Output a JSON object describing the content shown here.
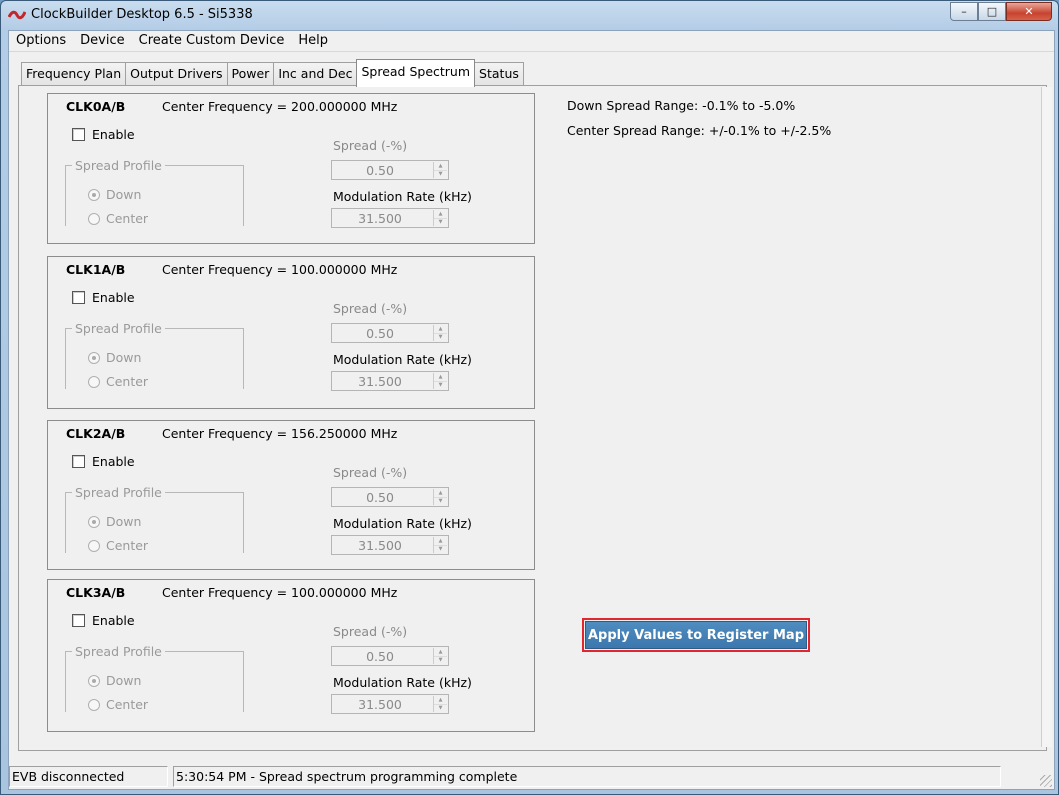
{
  "window": {
    "title": "ClockBuilder Desktop 6.5 - Si5338",
    "buttons": {
      "minimize": "–",
      "maximize": "□",
      "close": "✕"
    }
  },
  "menu": [
    "Options",
    "Device",
    "Create Custom Device",
    "Help"
  ],
  "tabs": [
    "Frequency Plan",
    "Output Drivers",
    "Power",
    "Inc and Dec",
    "Spread Spectrum",
    "Status"
  ],
  "active_tab": "Spread Spectrum",
  "clocks": [
    {
      "name": "CLK0A/B",
      "freq": "Center Frequency = 200.000000 MHz",
      "enable": "Enable",
      "profile_label": "Spread Profile",
      "down": "Down",
      "center": "Center",
      "spread_label": "Spread (-%)",
      "spread_value": "0.50",
      "mod_label": "Modulation Rate (kHz)",
      "mod_value": "31.500"
    },
    {
      "name": "CLK1A/B",
      "freq": "Center Frequency = 100.000000 MHz",
      "enable": "Enable",
      "profile_label": "Spread Profile",
      "down": "Down",
      "center": "Center",
      "spread_label": "Spread (-%)",
      "spread_value": "0.50",
      "mod_label": "Modulation Rate (kHz)",
      "mod_value": "31.500"
    },
    {
      "name": "CLK2A/B",
      "freq": "Center Frequency = 156.250000 MHz",
      "enable": "Enable",
      "profile_label": "Spread Profile",
      "down": "Down",
      "center": "Center",
      "spread_label": "Spread (-%)",
      "spread_value": "0.50",
      "mod_label": "Modulation Rate (kHz)",
      "mod_value": "31.500"
    },
    {
      "name": "CLK3A/B",
      "freq": "Center Frequency = 100.000000 MHz",
      "enable": "Enable",
      "profile_label": "Spread Profile",
      "down": "Down",
      "center": "Center",
      "spread_label": "Spread (-%)",
      "spread_value": "0.50",
      "mod_label": "Modulation Rate (kHz)",
      "mod_value": "31.500"
    }
  ],
  "info": {
    "down_range": "Down Spread Range: -0.1% to -5.0%",
    "center_range": "Center Spread Range: +/-0.1% to +/-2.5%"
  },
  "apply_button": "Apply Values to Register Map",
  "status": {
    "evb": "EVB disconnected",
    "message": "5:30:54 PM - Spread spectrum programming complete"
  },
  "colors": {
    "accent": "#4581b8",
    "highlight_border": "#e2262f"
  }
}
